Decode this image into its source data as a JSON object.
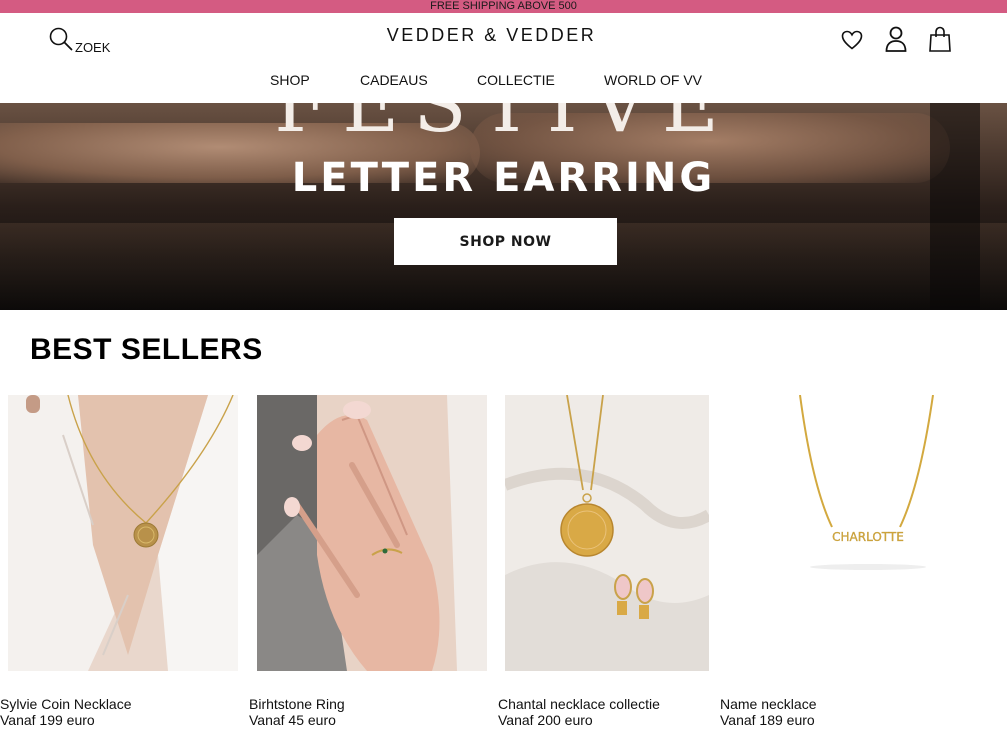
{
  "promo": {
    "text": "FREE SHIPPING ABOVE 500"
  },
  "header": {
    "search_label": "ZOEK",
    "logo": "VEDDER & VEDDER",
    "icons": [
      "heart-icon",
      "user-icon",
      "shopping-bag-icon"
    ]
  },
  "nav": {
    "items": [
      "SHOP",
      "CADEAUS",
      "COLLECTIE",
      "WORLD OF VV"
    ]
  },
  "hero": {
    "headline_top": "FESTIVE",
    "headline": "LETTER EARRING",
    "cta": "SHOP NOW"
  },
  "best_sellers": {
    "title": "BEST SELLERS",
    "products": [
      {
        "name": "Sylvie Coin Necklace",
        "price": "Vanaf 199 euro"
      },
      {
        "name": "Birhtstone Ring",
        "price": "Vanaf 45 euro"
      },
      {
        "name": "Chantal necklace collectie",
        "price": "Vanaf 200 euro"
      },
      {
        "name": "Name necklace",
        "price": "Vanaf 189 euro",
        "engraving": "CHARLOTTE"
      }
    ]
  },
  "colors": {
    "promo_bar": "#d45b82",
    "gold": "#c9a24a",
    "text": "#111111"
  }
}
